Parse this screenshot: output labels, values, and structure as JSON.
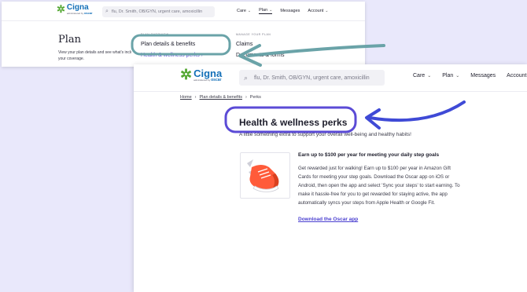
{
  "colors": {
    "background": "#e9e8fb",
    "highlight_teal": "#6aa3a8",
    "highlight_indigo": "#5b4bd6",
    "arrow_blue": "#3f4ad6",
    "brand_blue": "#1470b8",
    "brand_green": "#55a834"
  },
  "logo": {
    "brand": "Cigna",
    "tagline": "administered by",
    "partner": "oscar",
    "icon": "tree-logo-icon"
  },
  "search": {
    "placeholder": "flu, Dr. Smith, OB/GYN, urgent care, amoxicillin",
    "icon": "search-icon"
  },
  "nav": {
    "care": "Care",
    "plan": "Plan",
    "messages": "Messages",
    "account": "Account"
  },
  "plan_page": {
    "heading": "Plan",
    "description": "View your plan details and see what's included in your coverage."
  },
  "dropdown": {
    "col1_header": "PLAN OVERVIEW",
    "col1_links": [
      "Plan details & benefits",
      "Health & wellness perks"
    ],
    "col2_header": "MANAGE YOUR PLAN",
    "col2_links": [
      "Claims",
      "Documents & forms"
    ]
  },
  "perks_page": {
    "breadcrumb": [
      "Home",
      "Plan details & benefits",
      "Perks"
    ],
    "title": "Health & wellness perks",
    "subtitle": "A little something extra to support your overall well-being and healthy habits!",
    "perk": {
      "title": "Earn up to $100 per year for meeting your daily step goals",
      "description": "Get rewarded just for walking! Earn up to $100 per year in Amazon Gift Cards for meeting your step goals. Download the Oscar app on iOS or Android, then open the app and select 'Sync your steps' to start earning. To make it hassle-free for you to get rewarded for staying active, the app automatically syncs your steps from Apple Health or Google Fit.",
      "link": "Download the Oscar app",
      "icon": "sneaker-icon"
    }
  }
}
